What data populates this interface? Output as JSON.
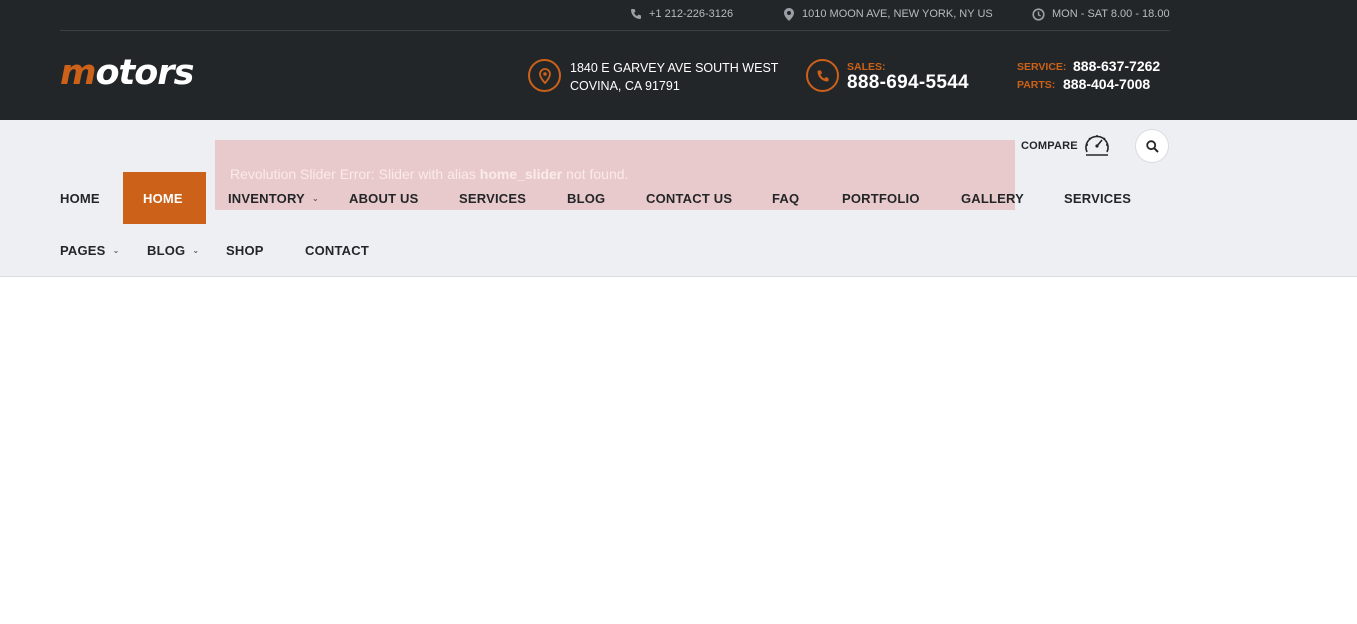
{
  "topbar": {
    "phone": "+1 212-226-3126",
    "address": "1010 MOON AVE, NEW YORK, NY US",
    "hours": "MON - SAT 8.00 - 18.00"
  },
  "header": {
    "logo_prefix": "m",
    "logo_rest": "otors",
    "address_line1": "1840 E GARVEY AVE SOUTH WEST",
    "address_line2": "COVINA, CA 91791",
    "sales_label": "SALES:",
    "sales_number": "888-694-5544",
    "service_label": "SERVICE:",
    "service_number": "888-637-7262",
    "parts_label": "PARTS:",
    "parts_number": "888-404-7008"
  },
  "slider_error": {
    "prefix": "Revolution Slider Error: Slider with alias ",
    "alias": "home_slider",
    "suffix": " not found."
  },
  "nav": {
    "row1": [
      "HOME",
      "HOME",
      "INVENTORY",
      "ABOUT US",
      "SERVICES",
      "BLOG",
      "CONTACT US",
      "FAQ",
      "PORTFOLIO",
      "GALLERY",
      "SERVICES"
    ],
    "row2": [
      "PAGES",
      "BLOG",
      "SHOP",
      "CONTACT"
    ],
    "compare_label": "COMPARE"
  },
  "colors": {
    "accent": "#cc6119",
    "dark": "#232628",
    "nav_bg": "#eeeff3",
    "error_bg": "#e9cacc"
  }
}
